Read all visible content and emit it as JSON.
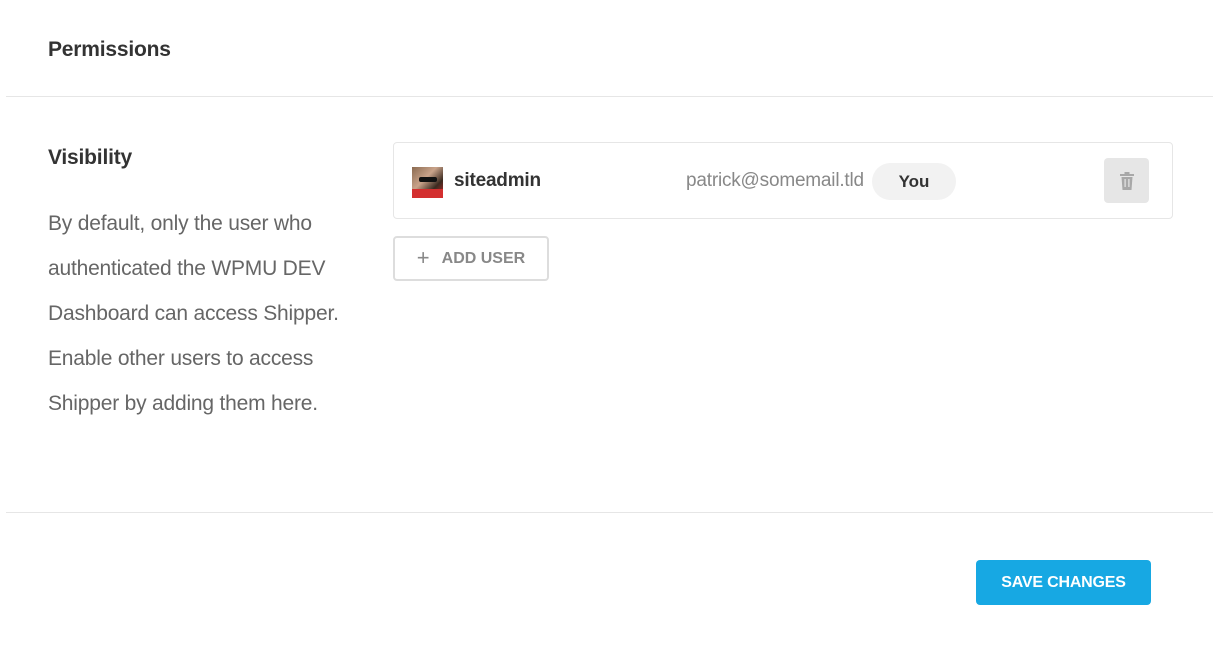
{
  "header": {
    "title": "Permissions"
  },
  "visibility": {
    "title": "Visibility",
    "description": "By default, only the user who authenticated the WPMU DEV Dashboard can access Shipper. Enable other users to access Shipper by adding them here."
  },
  "users": [
    {
      "name": "siteadmin",
      "email": "patrick@somemail.tld",
      "tag": "You",
      "avatar_icon": "user-avatar",
      "delete_icon": "trash-icon"
    }
  ],
  "actions": {
    "add_user_label": "ADD USER",
    "add_user_icon": "plus-icon",
    "save_label": "SAVE CHANGES"
  },
  "colors": {
    "accent": "#17a8e3",
    "text_dark": "#333333",
    "text_muted": "#666666",
    "border": "#e6e6e6"
  }
}
